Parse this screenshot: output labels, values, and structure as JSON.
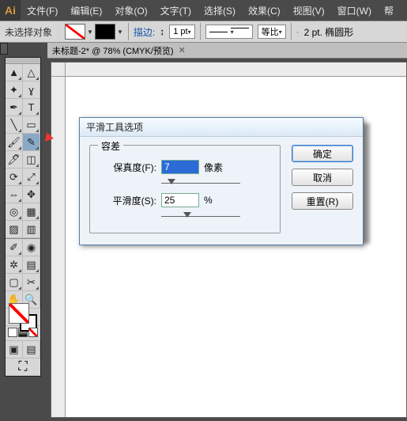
{
  "app": {
    "logo": "Ai"
  },
  "menu": {
    "items": [
      "文件(F)",
      "编辑(E)",
      "对象(O)",
      "文字(T)",
      "选择(S)",
      "效果(C)",
      "视图(V)",
      "窗口(W)",
      "帮"
    ]
  },
  "propbar": {
    "no_selection": "未选择对象",
    "stroke_label": "描边:",
    "stroke_value": "1 pt",
    "ratio_label": "等比",
    "shape_info": "2 pt. 椭圆形"
  },
  "doc": {
    "tab": "未标题-2* @ 78% (CMYK/预览)"
  },
  "dialog": {
    "title": "平滑工具选项",
    "legend": "容差",
    "fidelity_label": "保真度(F):",
    "fidelity_value": "7",
    "fidelity_unit": "像素",
    "smoothness_label": "平滑度(S):",
    "smoothness_value": "25",
    "smoothness_unit": "%",
    "ok": "确定",
    "cancel": "取消",
    "reset": "重置(R)"
  }
}
